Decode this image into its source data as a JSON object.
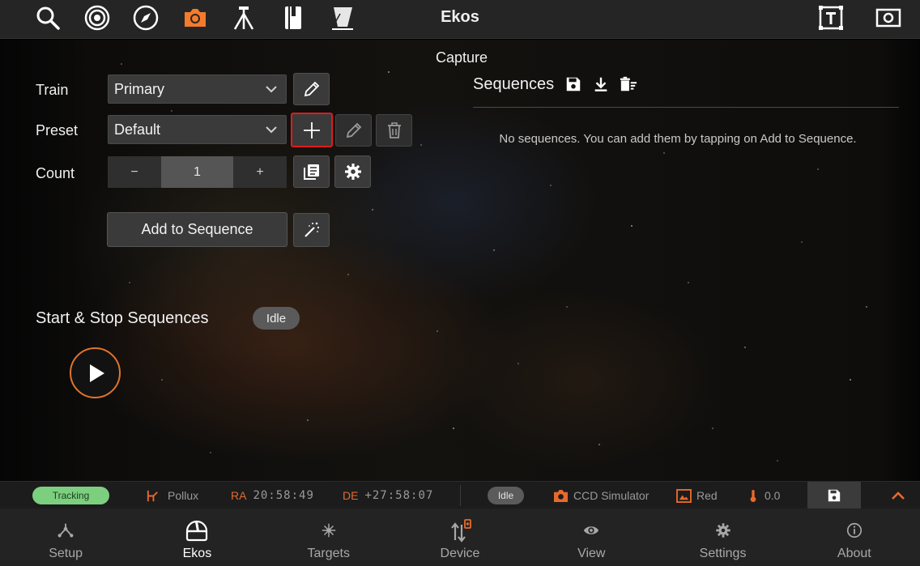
{
  "app": {
    "title": "Ekos"
  },
  "toolbar": {
    "icons": [
      "search-icon",
      "target-icon",
      "compass-icon",
      "camera-icon",
      "tripod-icon",
      "notebook-icon",
      "flat-panel-icon",
      "text-overlay-icon",
      "screen-capture-icon"
    ],
    "active_icon": "camera-icon",
    "accent": "#f47b2a"
  },
  "capture": {
    "title": "Capture",
    "train_label": "Train",
    "train_value": "Primary",
    "preset_label": "Preset",
    "preset_value": "Default",
    "count_label": "Count",
    "count_minus": "−",
    "count_value": "1",
    "count_plus": "+",
    "add_to_sequence": "Add to Sequence"
  },
  "sequences": {
    "title": "Sequences",
    "empty_message": "No sequences. You can add them by tapping on Add to Sequence."
  },
  "start_stop": {
    "title": "Start & Stop Sequences",
    "state": "Idle"
  },
  "status": {
    "tracking": "Tracking",
    "target": "Pollux",
    "ra_label": "RA",
    "ra_value": "20:58:49",
    "de_label": "DE",
    "de_value": "+27:58:07",
    "capture_state": "Idle",
    "camera": "CCD Simulator",
    "filter": "Red",
    "temperature": "0.0"
  },
  "nav": {
    "items": [
      {
        "label": "Setup",
        "icon": "network-icon"
      },
      {
        "label": "Ekos",
        "icon": "observatory-icon"
      },
      {
        "label": "Targets",
        "icon": "star-icon"
      },
      {
        "label": "Device",
        "icon": "device-icon"
      },
      {
        "label": "View",
        "icon": "eye-icon"
      },
      {
        "label": "Settings",
        "icon": "gear-icon"
      },
      {
        "label": "About",
        "icon": "info-icon"
      }
    ],
    "active": "Ekos"
  },
  "colors": {
    "accent_orange": "#f47b2a",
    "tracking_green": "#7ccf7f",
    "highlight_red": "#e01b1b"
  }
}
